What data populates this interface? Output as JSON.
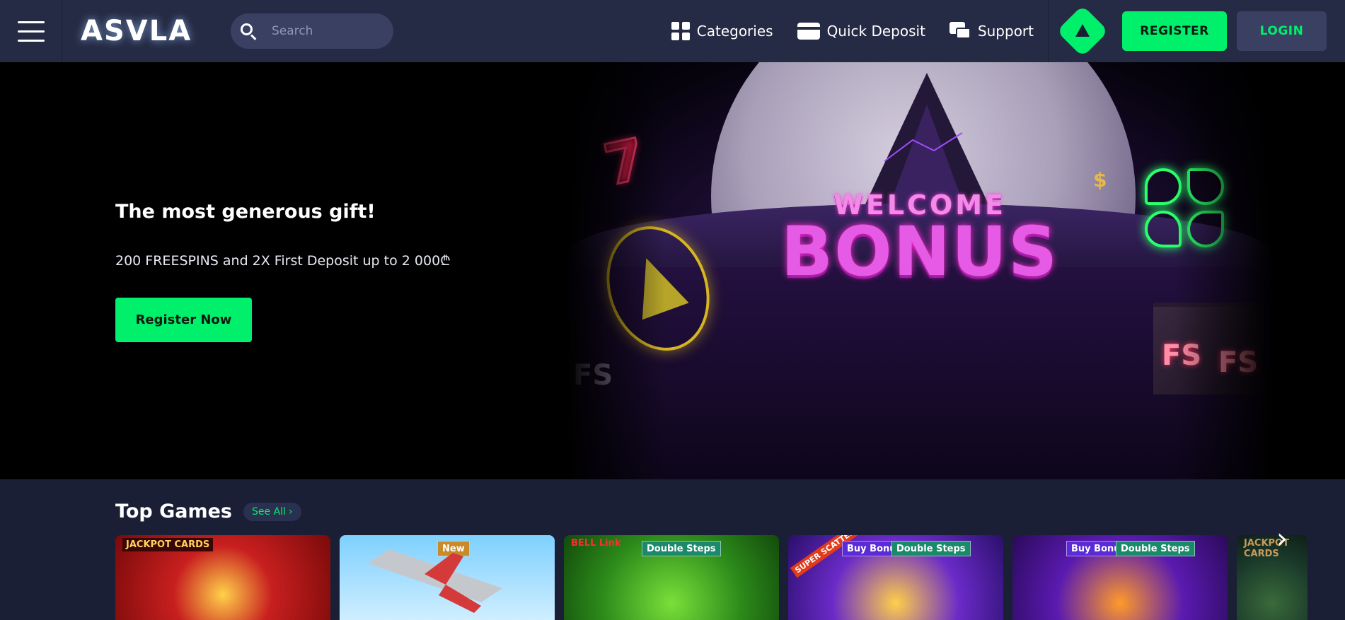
{
  "header": {
    "logo": "ASVLA",
    "search_placeholder": "Search",
    "nav": [
      {
        "label": "Categories",
        "icon": "grid-icon"
      },
      {
        "label": "Quick Deposit",
        "icon": "credit-card-icon"
      },
      {
        "label": "Support",
        "icon": "chat-bubbles-icon"
      }
    ],
    "register_label": "REGISTER",
    "login_label": "LOGIN",
    "accent_color": "#00f06b"
  },
  "hero": {
    "title": "The most generous gift!",
    "subtitle": "200 FREESPINS and 2X First Deposit up to 2 000₾",
    "cta_label": "Register Now",
    "banner": {
      "welcome": "WELCOME",
      "bonus": "BONUS",
      "fs": "FS"
    }
  },
  "top_games": {
    "title": "Top Games",
    "see_all": "See All",
    "cards": [
      {
        "tags": [],
        "corner_label": "JACKPOT CARDS"
      },
      {
        "tags": [
          "New"
        ],
        "corner_label": ""
      },
      {
        "tags": [
          "Double Steps"
        ],
        "corner_label": "BELL Link"
      },
      {
        "tags": [
          "Buy Bonus",
          "Double Steps"
        ],
        "corner_label": "SUPER SCATTER"
      },
      {
        "tags": [
          "Buy Bonus",
          "Double Steps"
        ],
        "corner_label": ""
      },
      {
        "tags": [],
        "corner_label": "JACKPOT CARDS"
      }
    ]
  }
}
